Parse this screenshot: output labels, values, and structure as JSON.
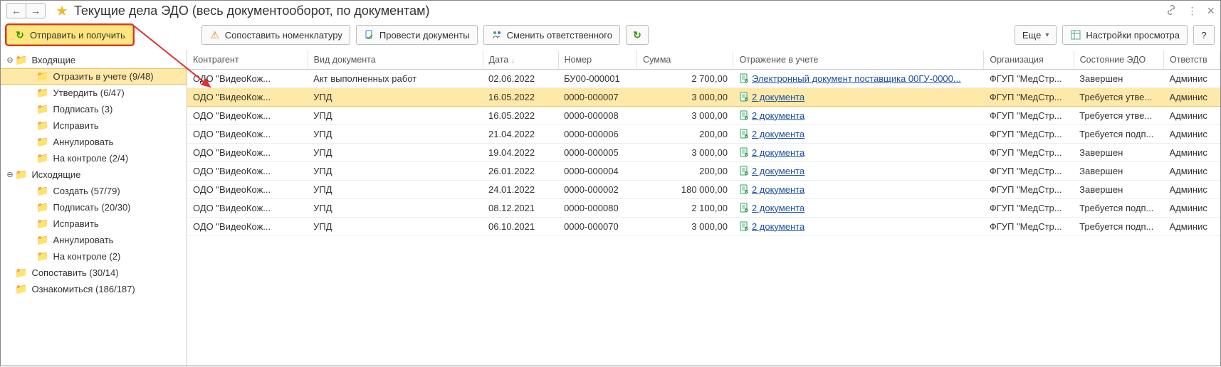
{
  "titlebar": {
    "back": "←",
    "forward": "→",
    "star": "★",
    "title": "Текущие дела ЭДО (весь документооборот, по документам)",
    "link_icon": "⚓",
    "more_icon": "⋮",
    "close_icon": "×"
  },
  "toolbar": {
    "send_receive": "Отправить и получить",
    "map_nomen": "Сопоставить номенклатуру",
    "post_docs": "Провести документы",
    "change_resp": "Сменить ответственного",
    "refresh": "↻",
    "more": "Еще",
    "view_settings": "Настройки просмотра",
    "help": "?"
  },
  "sidebar": {
    "items": [
      {
        "expander": "⊖",
        "level": 0,
        "label": "Входящие",
        "selected": false
      },
      {
        "expander": "",
        "level": 2,
        "label": "Отразить в учете (9/48)",
        "selected": true
      },
      {
        "expander": "",
        "level": 2,
        "label": "Утвердить (6/47)",
        "selected": false
      },
      {
        "expander": "",
        "level": 2,
        "label": "Подписать (3)",
        "selected": false
      },
      {
        "expander": "",
        "level": 2,
        "label": "Исправить",
        "selected": false
      },
      {
        "expander": "",
        "level": 2,
        "label": "Аннулировать",
        "selected": false
      },
      {
        "expander": "",
        "level": 2,
        "label": "На контроле (2/4)",
        "selected": false
      },
      {
        "expander": "⊖",
        "level": 0,
        "label": "Исходящие",
        "selected": false
      },
      {
        "expander": "",
        "level": 2,
        "label": "Создать (57/79)",
        "selected": false
      },
      {
        "expander": "",
        "level": 2,
        "label": "Подписать (20/30)",
        "selected": false
      },
      {
        "expander": "",
        "level": 2,
        "label": "Исправить",
        "selected": false
      },
      {
        "expander": "",
        "level": 2,
        "label": "Аннулировать",
        "selected": false
      },
      {
        "expander": "",
        "level": 2,
        "label": "На контроле (2)",
        "selected": false
      },
      {
        "expander": "",
        "level": 0,
        "label": "Сопоставить (30/14)",
        "selected": false
      },
      {
        "expander": "",
        "level": 0,
        "label": "Ознакомиться (186/187)",
        "selected": false
      }
    ]
  },
  "table": {
    "columns": {
      "ka": "Контрагент",
      "vd": "Вид документа",
      "dt": "Дата",
      "nm": "Номер",
      "sm": "Сумма",
      "ou": "Отражение в учете",
      "og": "Организация",
      "se": "Состояние ЭДО",
      "ot": "Ответств"
    },
    "rows": [
      {
        "ka": "ОДО \"ВидеоКож...",
        "vd": "Акт выполненных работ",
        "dt": "02.06.2022",
        "nm": "БУ00-000001",
        "sm": "2 700,00",
        "ou": "Электронный документ поставщика 00ГУ-0000...",
        "og": "ФГУП \"МедСтр...",
        "se": "Завершен",
        "ot": "Админис",
        "sel": false
      },
      {
        "ka": "ОДО \"ВидеоКож...",
        "vd": "УПД",
        "dt": "16.05.2022",
        "nm": "0000-000007",
        "sm": "3 000,00",
        "ou": "2 документа",
        "og": "ФГУП \"МедСтр...",
        "se": "Требуется утве...",
        "ot": "Админис",
        "sel": true
      },
      {
        "ka": "ОДО \"ВидеоКож...",
        "vd": "УПД",
        "dt": "16.05.2022",
        "nm": "0000-000008",
        "sm": "3 000,00",
        "ou": "2 документа",
        "og": "ФГУП \"МедСтр...",
        "se": "Требуется утве...",
        "ot": "Админис",
        "sel": false
      },
      {
        "ka": "ОДО \"ВидеоКож...",
        "vd": "УПД",
        "dt": "21.04.2022",
        "nm": "0000-000006",
        "sm": "200,00",
        "ou": "2 документа",
        "og": "ФГУП \"МедСтр...",
        "se": "Требуется подп...",
        "ot": "Админис",
        "sel": false
      },
      {
        "ka": "ОДО \"ВидеоКож...",
        "vd": "УПД",
        "dt": "19.04.2022",
        "nm": "0000-000005",
        "sm": "3 000,00",
        "ou": "2 документа",
        "og": "ФГУП \"МедСтр...",
        "se": "Завершен",
        "ot": "Админис",
        "sel": false
      },
      {
        "ka": "ОДО \"ВидеоКож...",
        "vd": "УПД",
        "dt": "26.01.2022",
        "nm": "0000-000004",
        "sm": "200,00",
        "ou": "2 документа",
        "og": "ФГУП \"МедСтр...",
        "se": "Завершен",
        "ot": "Админис",
        "sel": false
      },
      {
        "ka": "ОДО \"ВидеоКож...",
        "vd": "УПД",
        "dt": "24.01.2022",
        "nm": "0000-000002",
        "sm": "180 000,00",
        "ou": "2 документа",
        "og": "ФГУП \"МедСтр...",
        "se": "Завершен",
        "ot": "Админис",
        "sel": false
      },
      {
        "ka": "ОДО \"ВидеоКож...",
        "vd": "УПД",
        "dt": "08.12.2021",
        "nm": "0000-000080",
        "sm": "2 100,00",
        "ou": "2 документа",
        "og": "ФГУП \"МедСтр...",
        "se": "Требуется подп...",
        "ot": "Админис",
        "sel": false
      },
      {
        "ka": "ОДО \"ВидеоКож...",
        "vd": "УПД",
        "dt": "06.10.2021",
        "nm": "0000-000070",
        "sm": "3 000,00",
        "ou": "2 документа",
        "og": "ФГУП \"МедСтр...",
        "se": "Требуется подп...",
        "ot": "Админис",
        "sel": false
      }
    ]
  }
}
